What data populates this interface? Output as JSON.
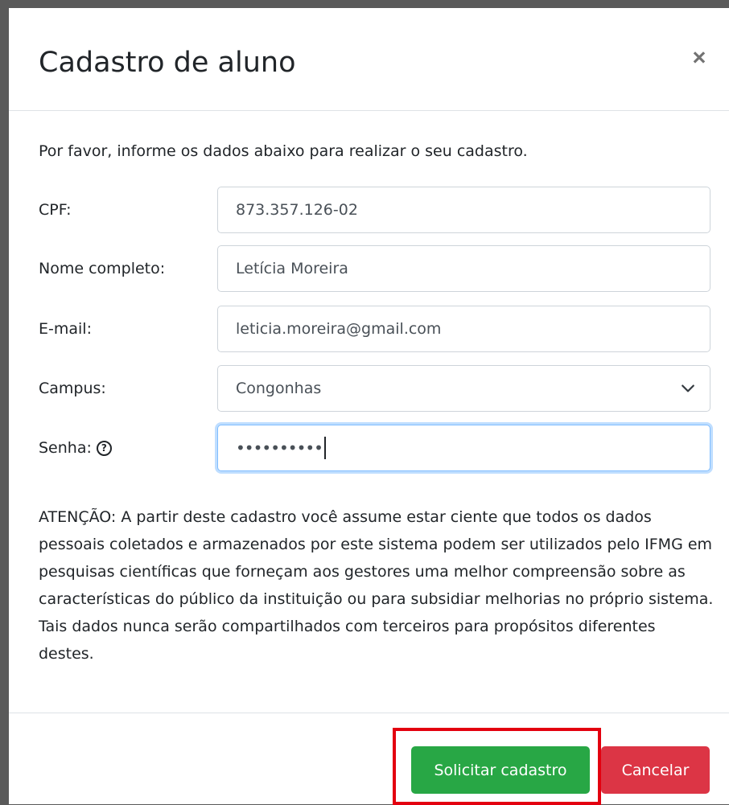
{
  "modal": {
    "title": "Cadastro de aluno",
    "close_symbol": "×",
    "intro": "Por favor, informe os dados abaixo para realizar o seu cadastro.",
    "fields": {
      "cpf": {
        "label": "CPF:",
        "value": "873.357.126-02"
      },
      "nome": {
        "label": "Nome completo:",
        "value": "Letícia Moreira"
      },
      "email": {
        "label": "E-mail:",
        "value": "leticia.moreira@gmail.com"
      },
      "campus": {
        "label": "Campus:",
        "value": "Congonhas"
      },
      "senha": {
        "label": "Senha:",
        "value": "••••••••••",
        "help_symbol": "?"
      }
    },
    "notice": "ATENÇÃO: A partir deste cadastro você assume estar ciente que todos os dados pessoais coletados e armazenados por este sistema podem ser utilizados pelo IFMG em pesquisas científicas que forneçam aos gestores uma melhor compreensão sobre as características do público da instituição ou para subsidiar melhorias no próprio sistema. Tais dados nunca serão compartilhados com terceiros para propósitos diferentes destes.",
    "buttons": {
      "submit": "Solicitar cadastro",
      "cancel": "Cancelar"
    }
  },
  "icons": {
    "close": "close-icon",
    "chevron": "chevron-down-icon",
    "help": "help-circle-icon"
  },
  "colors": {
    "success": "#28a745",
    "danger": "#dc3545",
    "highlight": "#e3000f",
    "focus": "#80bdff"
  }
}
